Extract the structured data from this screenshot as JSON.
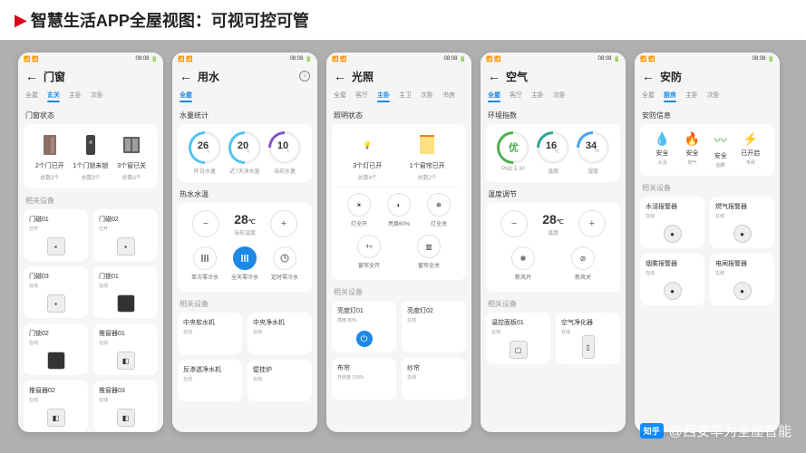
{
  "header": {
    "title": "智慧生活APP全屋视图：可视可控可管"
  },
  "status": {
    "time": "08:08"
  },
  "phones": [
    {
      "title": "门窗",
      "tabs": [
        "全屋",
        "玄关",
        "主卧",
        "次卧"
      ],
      "active": 1,
      "section1": "门窗状态",
      "items": [
        {
          "label": "2个门已开",
          "sub": "总数3个"
        },
        {
          "label": "1个门锁未锁",
          "sub": "总数3个"
        },
        {
          "label": "3个窗已关",
          "sub": "总数3个"
        }
      ],
      "section2": "相关设备",
      "devices": [
        {
          "name": "门磁01",
          "sub": "已开"
        },
        {
          "name": "门磁02",
          "sub": "已开"
        },
        {
          "name": "门磁03",
          "sub": "在线"
        },
        {
          "name": "门锁01",
          "sub": "在线"
        },
        {
          "name": "门锁02",
          "sub": "在线"
        },
        {
          "name": "推窗器01",
          "sub": "在线"
        },
        {
          "name": "推窗器02",
          "sub": "在线"
        },
        {
          "name": "推窗器03",
          "sub": "在线"
        }
      ]
    },
    {
      "title": "用水",
      "info": true,
      "tabs": [
        "全屋"
      ],
      "active": 0,
      "section1": "水量统计",
      "rings": [
        {
          "val": "26",
          "unit": "L",
          "sub": "昨日水量",
          "cls": "blue"
        },
        {
          "val": "20",
          "unit": "L",
          "sub": "近7天净水量",
          "cls": "blue"
        },
        {
          "val": "10",
          "unit": "L",
          "sub": "当前水量",
          "cls": "purple"
        }
      ],
      "section1b": "热水水温",
      "temp": {
        "val": "28",
        "unit": "℃",
        "sub": "当前温度"
      },
      "icons": [
        {
          "label": "单次零冷水"
        },
        {
          "label": "全天零冷水",
          "active": true
        },
        {
          "label": "定时零冷水"
        }
      ],
      "section2": "相关设备",
      "devices": [
        {
          "name": "中央软水机",
          "sub": "在线"
        },
        {
          "name": "中央净水机",
          "sub": "在线"
        },
        {
          "name": "反渗透净水机",
          "sub": "在线"
        },
        {
          "name": "壁挂炉",
          "sub": "在线"
        }
      ]
    },
    {
      "title": "光照",
      "tabs": [
        "全屋",
        "客厅",
        "主卧",
        "主卫",
        "次卧",
        "书房"
      ],
      "active": 2,
      "section1": "照明状态",
      "items": [
        {
          "label": "3个灯已开",
          "sub": "总数4个"
        },
        {
          "label": "1个窗帘已开",
          "sub": "总数2个"
        }
      ],
      "icons1": [
        {
          "label": "灯全开"
        },
        {
          "label": "亮度60%"
        },
        {
          "label": "灯全关"
        }
      ],
      "icons2": [
        {
          "label": "窗帘全开"
        },
        {
          "label": "窗帘全关"
        }
      ],
      "section2": "相关设备",
      "devices": [
        {
          "name": "亮度灯01",
          "sub": "亮度 80%"
        },
        {
          "name": "亮度灯02",
          "sub": "在线"
        },
        {
          "name": "布帘",
          "sub": "开启度 100%"
        },
        {
          "name": "纱帘",
          "sub": "在线"
        }
      ]
    },
    {
      "title": "空气",
      "tabs": [
        "全屋",
        "客厅",
        "主卧",
        "次卧"
      ],
      "active": 0,
      "section1": "环境指数",
      "rings": [
        {
          "val": "优",
          "unit": "",
          "sub": "PM2.5 30",
          "cls": "green"
        },
        {
          "val": "16",
          "unit": "℃",
          "sub": "温度",
          "cls": "teal"
        },
        {
          "val": "34",
          "unit": "%",
          "sub": "湿度",
          "cls": "blue2"
        }
      ],
      "section1b": "温度调节",
      "temp": {
        "val": "28",
        "unit": "℃",
        "sub": "温度"
      },
      "icons": [
        {
          "label": "新风开"
        },
        {
          "label": "新风关"
        }
      ],
      "section2": "相关设备",
      "devices": [
        {
          "name": "温控面板01",
          "sub": "在线"
        },
        {
          "name": "空气净化器",
          "sub": "在线"
        }
      ]
    },
    {
      "title": "安防",
      "tabs": [
        "全屋",
        "厨房",
        "主卧",
        "次卧"
      ],
      "active": 1,
      "section1": "安防信息",
      "safety": [
        {
          "icon": "💧",
          "label": "安全",
          "sub": "水浸",
          "cls": "green"
        },
        {
          "icon": "🔥",
          "label": "安全",
          "sub": "燃气",
          "cls": "green"
        },
        {
          "icon": "〰",
          "label": "安全",
          "sub": "烟雾",
          "cls": "green"
        },
        {
          "icon": "⚡",
          "label": "已开启",
          "sub": "电闸",
          "cls": "yellow"
        }
      ],
      "section2": "相关设备",
      "devices": [
        {
          "name": "水浸报警器",
          "sub": "在线"
        },
        {
          "name": "燃气报警器",
          "sub": "在线"
        },
        {
          "name": "烟雾报警器",
          "sub": "在线"
        },
        {
          "name": "电闸报警器",
          "sub": "在线"
        }
      ]
    }
  ],
  "watermark": "@西安华为全屋智能",
  "zhihu": "知乎"
}
